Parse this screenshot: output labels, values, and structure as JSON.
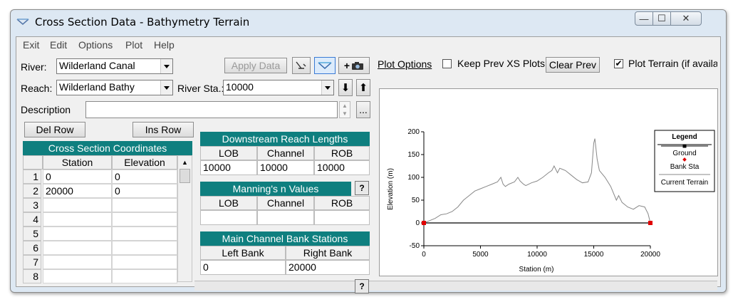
{
  "window": {
    "title": "Cross Section Data - Bathymetry Terrain",
    "min": "—",
    "max": "☐",
    "close": "✕"
  },
  "menu": [
    "Exit",
    "Edit",
    "Options",
    "Plot",
    "Help"
  ],
  "river": {
    "label": "River:",
    "value": "Wilderland Canal"
  },
  "reach": {
    "label": "Reach:",
    "value": "Wilderland Bathy"
  },
  "river_sta": {
    "label": "River Sta.:",
    "value": "10000"
  },
  "description": {
    "label": "Description",
    "value": "",
    "ellipsis": "..."
  },
  "buttons": {
    "apply": "Apply Data",
    "del_row": "Del Row",
    "ins_row": "Ins Row",
    "down_arrow": "⬇",
    "up_arrow": "⬆",
    "add": "+",
    "help": "?"
  },
  "xs_coords": {
    "title": "Cross Section Coordinates",
    "columns": [
      "Station",
      "Elevation"
    ],
    "rows": [
      {
        "n": "1",
        "station": "0",
        "elevation": "0"
      },
      {
        "n": "2",
        "station": "20000",
        "elevation": "0"
      },
      {
        "n": "3",
        "station": "",
        "elevation": ""
      },
      {
        "n": "4",
        "station": "",
        "elevation": ""
      },
      {
        "n": "5",
        "station": "",
        "elevation": ""
      },
      {
        "n": "6",
        "station": "",
        "elevation": ""
      },
      {
        "n": "7",
        "station": "",
        "elevation": ""
      },
      {
        "n": "8",
        "station": "",
        "elevation": ""
      }
    ]
  },
  "reach_lengths": {
    "title": "Downstream Reach Lengths",
    "columns": [
      "LOB",
      "Channel",
      "ROB"
    ],
    "values": [
      "10000",
      "10000",
      "10000"
    ]
  },
  "mannings": {
    "title": "Manning's n Values",
    "columns": [
      "LOB",
      "Channel",
      "ROB"
    ],
    "values": [
      "",
      "",
      ""
    ]
  },
  "bank_stations": {
    "title": "Main Channel Bank Stations",
    "columns": [
      "Left Bank",
      "Right Bank"
    ],
    "values": [
      "0",
      "20000"
    ]
  },
  "plot_options": {
    "link": "Plot Options",
    "keep_prev": "Keep Prev XS Plots",
    "keep_prev_checked": false,
    "clear_prev": "Clear Prev",
    "plot_terrain": "Plot Terrain (if availab",
    "plot_terrain_checked": true
  },
  "legend": {
    "title": "Legend",
    "items": [
      "Ground",
      "Bank Sta",
      "Current Terrain"
    ]
  },
  "chart_data": {
    "type": "line",
    "xlabel": "Station (m)",
    "ylabel": "Elevation (m)",
    "xlim": [
      0,
      20000
    ],
    "ylim": [
      -50,
      200
    ],
    "x_ticks": [
      0,
      5000,
      10000,
      15000,
      20000
    ],
    "y_ticks": [
      -50,
      0,
      50,
      100,
      150,
      200
    ],
    "series": [
      {
        "name": "Ground",
        "color": "#000000",
        "x": [
          0,
          20000
        ],
        "y": [
          0,
          0
        ]
      },
      {
        "name": "Current Terrain",
        "color": "#888888",
        "x": [
          0,
          500,
          1000,
          1500,
          2000,
          2500,
          3000,
          3500,
          4000,
          4500,
          5000,
          5500,
          6000,
          6500,
          6800,
          7000,
          7200,
          7500,
          8000,
          8300,
          8500,
          8800,
          9000,
          9500,
          10000,
          10500,
          11000,
          11300,
          11500,
          11800,
          12000,
          12200,
          12500,
          13000,
          13500,
          14000,
          14500,
          14800,
          15000,
          15100,
          15300,
          15500,
          16000,
          16500,
          17000,
          17200,
          17500,
          18000,
          18500,
          19000,
          19500,
          19800,
          20000
        ],
        "y": [
          0,
          5,
          10,
          18,
          20,
          25,
          35,
          50,
          60,
          70,
          75,
          80,
          85,
          90,
          100,
          85,
          80,
          85,
          90,
          100,
          92,
          85,
          82,
          88,
          92,
          100,
          110,
          115,
          125,
          110,
          120,
          118,
          115,
          105,
          95,
          88,
          90,
          110,
          175,
          185,
          140,
          115,
          100,
          80,
          50,
          60,
          45,
          35,
          30,
          38,
          35,
          20,
          0
        ]
      },
      {
        "name": "Bank Sta",
        "color": "#e00000",
        "x": [
          0,
          20000
        ],
        "y": [
          0,
          0
        ]
      }
    ]
  }
}
